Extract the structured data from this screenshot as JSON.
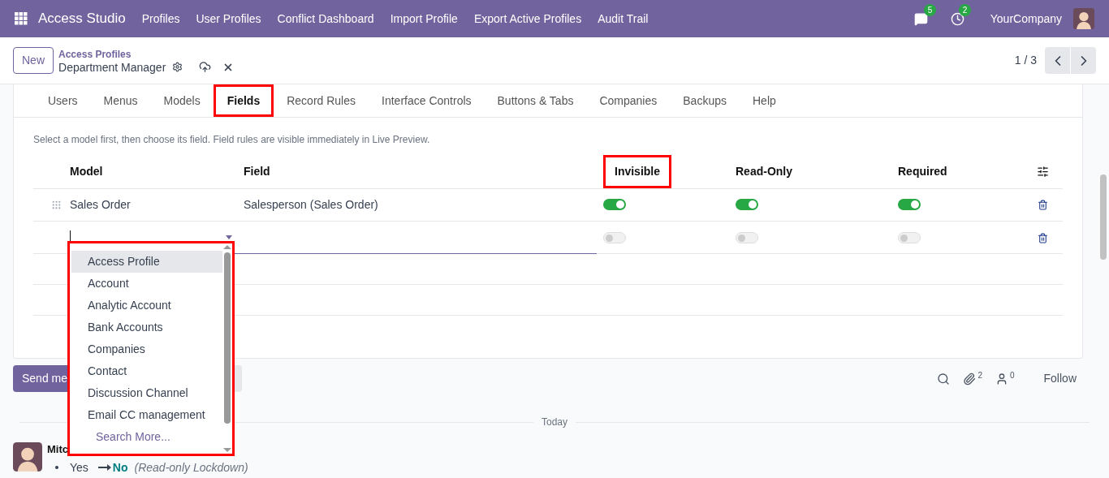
{
  "navbar": {
    "app_name": "Access Studio",
    "menu": [
      "Profiles",
      "User Profiles",
      "Conflict Dashboard",
      "Import Profile",
      "Export Active Profiles",
      "Audit Trail"
    ],
    "messages_count": "5",
    "activities_count": "2",
    "company": "YourCompany"
  },
  "control_panel": {
    "new_button": "New",
    "breadcrumb": "Access Profiles",
    "record_name": "Department Manager",
    "pager": "1 / 3"
  },
  "tabs": [
    {
      "label": "Users",
      "selected": false,
      "highlighted": false
    },
    {
      "label": "Menus",
      "selected": false,
      "highlighted": false
    },
    {
      "label": "Models",
      "selected": false,
      "highlighted": false
    },
    {
      "label": "Fields",
      "selected": true,
      "highlighted": true
    },
    {
      "label": "Record Rules",
      "selected": false,
      "highlighted": false
    },
    {
      "label": "Interface Controls",
      "selected": false,
      "highlighted": false
    },
    {
      "label": "Buttons & Tabs",
      "selected": false,
      "highlighted": false
    },
    {
      "label": "Companies",
      "selected": false,
      "highlighted": false
    },
    {
      "label": "Backups",
      "selected": false,
      "highlighted": false
    },
    {
      "label": "Help",
      "selected": false,
      "highlighted": false
    }
  ],
  "hint": "Select a model first, then choose its field. Field rules are visible immediately in Live Preview.",
  "table": {
    "columns": [
      {
        "label": "Model",
        "highlighted": false
      },
      {
        "label": "Field",
        "highlighted": false
      },
      {
        "label": "Invisible",
        "highlighted": true
      },
      {
        "label": "Read-Only",
        "highlighted": false
      },
      {
        "label": "Required",
        "highlighted": false
      }
    ],
    "rows": [
      {
        "kind": "record",
        "model": "Sales Order",
        "field": "Salesperson (Sales Order)",
        "invisible": true,
        "read_only": true,
        "required": true
      },
      {
        "kind": "input",
        "invisible": false,
        "read_only": false,
        "required": false
      }
    ]
  },
  "dropdown": {
    "highlighted": true,
    "items": [
      {
        "label": "Access Profile",
        "selected": true
      },
      {
        "label": "Account",
        "selected": false
      },
      {
        "label": "Analytic Account",
        "selected": false
      },
      {
        "label": "Bank Accounts",
        "selected": false
      },
      {
        "label": "Companies",
        "selected": false
      },
      {
        "label": "Contact",
        "selected": false
      },
      {
        "label": "Discussion Channel",
        "selected": false
      },
      {
        "label": "Email CC management",
        "selected": false
      }
    ],
    "search_more": "Search More..."
  },
  "chatter": {
    "send_button": "Send me",
    "attachments_count": "2",
    "followers_count": "0",
    "follow": "Follow",
    "date_divider": "Today",
    "message": {
      "author": "Mitc",
      "old_value": "Yes",
      "new_value": "No",
      "field": "(Read-only Lockdown)"
    }
  }
}
